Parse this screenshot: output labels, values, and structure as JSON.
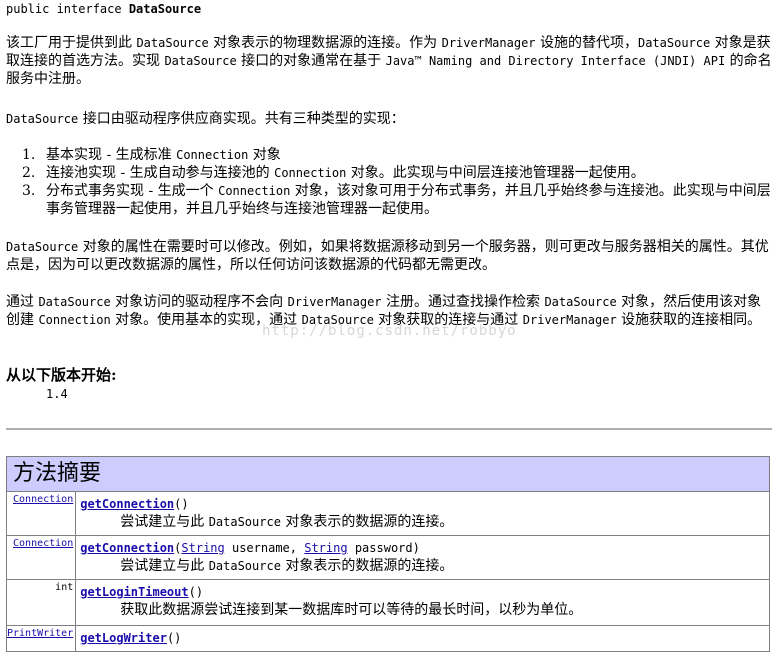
{
  "signature": {
    "prefix": "public interface ",
    "name": "DataSource"
  },
  "para1": {
    "t1": "该工厂用于提供到此 ",
    "c1": "DataSource",
    "t2": " 对象表示的物理数据源的连接。作为 ",
    "c2": "DriverManager",
    "t3": " 设施的替代项，",
    "c3": "DataSource",
    "t4": " 对象是获取连接的首选方法。实现 ",
    "c4": "DataSource",
    "t5": " 接口的对象通常在基于 ",
    "c5": "Java™ Naming and Directory Interface (JNDI) API",
    "t6": " 的命名服务中注册。"
  },
  "para2": {
    "c1": "DataSource",
    "t1": " 接口由驱动程序供应商实现。共有三种类型的实现："
  },
  "list": [
    {
      "num": "1.",
      "t1": "基本实现 - 生成标准 ",
      "c1": "Connection",
      "t2": " 对象"
    },
    {
      "num": "2.",
      "t1": "连接池实现 - 生成自动参与连接池的 ",
      "c1": "Connection",
      "t2": " 对象。此实现与中间层连接池管理器一起使用。"
    },
    {
      "num": "3.",
      "t1": "分布式事务实现 - 生成一个 ",
      "c1": "Connection",
      "t2": " 对象，该对象可用于分布式事务，并且几乎始终参与连接池。此实现与中间层事务管理器一起使用，并且几乎始终与连接池管理器一起使用。"
    }
  ],
  "para3": {
    "c1": "DataSource",
    "t1": " 对象的属性在需要时可以修改。例如，如果将数据源移动到另一个服务器，则可更改与服务器相关的属性。其优点是，因为可以更改数据源的属性，所以任何访问该数据源的代码都无需更改。"
  },
  "para4": {
    "t1": "通过 ",
    "c1": "DataSource",
    "t2": " 对象访问的驱动程序不会向 ",
    "c2": "DriverManager",
    "t3": " 注册。通过查找操作检索 ",
    "c3": "DataSource",
    "t4": " 对象，然后使用该对象创建 ",
    "c4": "Connection",
    "t5": " 对象。使用基本的实现，通过 ",
    "c5": "DataSource",
    "t6": " 对象获取的连接与通过 ",
    "c6": "DriverManager",
    "t7": " 设施获取的连接相同。"
  },
  "since": {
    "label": "从以下版本开始:",
    "value": "1.4"
  },
  "watermark": "http://blog.csdn.net/robbyo",
  "method_summary": {
    "title": "方法摘要",
    "rows": [
      {
        "type": "Connection",
        "method": "getConnection",
        "sig_open": "(",
        "sig_close": ")",
        "desc_t1": "尝试建立与此 ",
        "desc_c1": "DataSource",
        "desc_t2": " 对象表示的数据源的连接。"
      },
      {
        "type": "Connection",
        "method": "getConnection",
        "sig_open": "(",
        "p1_type": "String",
        "p1_name": " username, ",
        "p2_type": "String",
        "p2_name": " password)",
        "desc_t1": "尝试建立与此 ",
        "desc_c1": "DataSource",
        "desc_t2": " 对象表示的数据源的连接。"
      },
      {
        "type": "int",
        "method": "getLoginTimeout",
        "sig_open": "(",
        "sig_close": ")",
        "desc": "获取此数据源尝试连接到某一数据库时可以等待的最长时间，以秒为单位。"
      },
      {
        "type": "PrintWriter",
        "method": "getLogWriter",
        "sig_open": "(",
        "sig_close": ")"
      }
    ]
  }
}
